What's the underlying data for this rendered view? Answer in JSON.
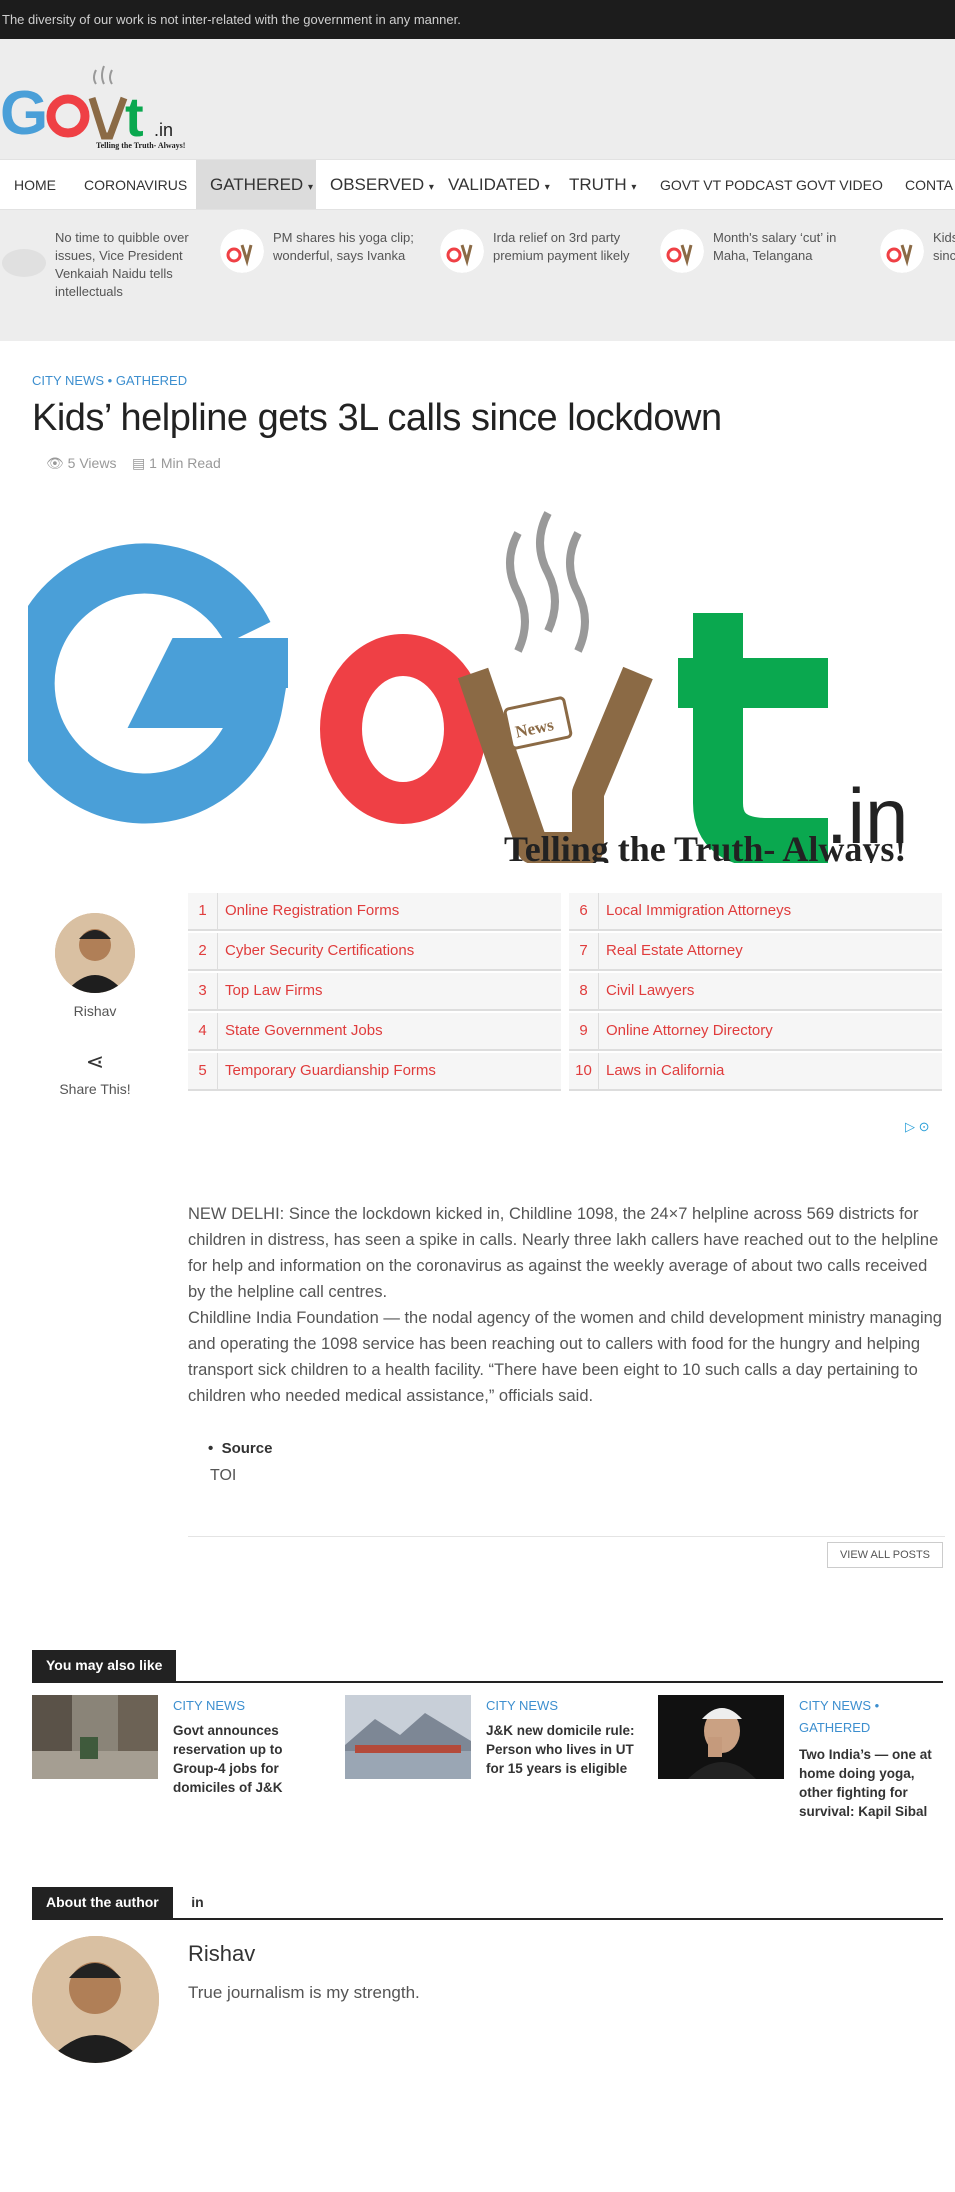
{
  "topbar": {
    "text": "The diversity of our work is not inter-related with the government in any manner."
  },
  "logo": {
    "tagline": "Telling the Truth- Always!",
    "domain": ".in",
    "cup_label": "News"
  },
  "nav": {
    "items": [
      {
        "label": "Home"
      },
      {
        "label": "Coronavirus"
      },
      {
        "label": "Gathered"
      },
      {
        "label": "Observed"
      },
      {
        "label": "Validated"
      },
      {
        "label": "Truth"
      },
      {
        "label": "Govt VT Podcast"
      },
      {
        "label": "Govt Video"
      },
      {
        "label": "Conta"
      }
    ]
  },
  "ticker": [
    {
      "text": "No time to quibble over issues, Vice President Venkaiah Naidu tells intellectuals"
    },
    {
      "text": "PM shares his yoga clip; wonderful, says Ivanka"
    },
    {
      "text": "Irda relief on 3rd party premium payment likely"
    },
    {
      "text": "Month's salary ‘cut’ in Maha, Telangana"
    },
    {
      "text": "Kids’ sinc"
    }
  ],
  "article": {
    "cat1": "City News",
    "sep": "•",
    "cat2": "Gathered",
    "title": "Kids’ helpline gets 3L calls since lockdown",
    "views": "5 Views",
    "read": "1 Min Read",
    "author": "Rishav",
    "share": "Share This!",
    "para1": "NEW DELHI: Since the lockdown kicked in, Childline 1098, the 24×7 helpline across 569 districts for children in distress, has seen a spike in calls. Nearly three lakh callers have reached out to the helpline for help and information on the coronavirus as against the weekly average of about two calls received by the helpline call centres.",
    "para2": "Childline India Foundation — the nodal agency of the women and child development ministry managing and operating the 1098 service has been reaching out to callers with food for the hungry and helping transport sick children to a health facility. “There have been eight to 10 such calls a day pertaining to children who needed medical assistance,” officials said.",
    "source_label": "Source",
    "source_value": "TOI"
  },
  "ads": [
    {
      "num": "1",
      "label": "Online Registration Forms"
    },
    {
      "num": "2",
      "label": "Cyber Security Certifications"
    },
    {
      "num": "3",
      "label": "Top Law Firms"
    },
    {
      "num": "4",
      "label": "State Government Jobs"
    },
    {
      "num": "5",
      "label": "Temporary Guardianship Forms"
    },
    {
      "num": "6",
      "label": "Local Immigration Attorneys"
    },
    {
      "num": "7",
      "label": "Real Estate Attorney"
    },
    {
      "num": "8",
      "label": "Civil Lawyers"
    },
    {
      "num": "9",
      "label": "Online Attorney Directory"
    },
    {
      "num": "10",
      "label": "Laws in California"
    }
  ],
  "related": {
    "heading": "You may also like",
    "items": [
      {
        "cat": "City News",
        "title": "Govt announces reservation up to Group-4 jobs for domiciles of J&K"
      },
      {
        "cat": "City News",
        "title": "J&K new domicile rule: Person who lives in UT for 15 years is eligible"
      },
      {
        "cat": "City News • Gathered",
        "title": "Two India’s — one at home doing yoga, other fighting for survival: Kapil Sibal"
      }
    ]
  },
  "about": {
    "heading": "About the author",
    "social": "in",
    "view_all": "View all posts",
    "name": "Rishav",
    "bio": "True journalism is my strength."
  },
  "colors": {
    "blue": "#4a9fd8",
    "red": "#ef4045",
    "brown": "#8b6a45",
    "green": "#0aa84f",
    "link": "#3d8fcf",
    "ad": "#e03c3c"
  }
}
